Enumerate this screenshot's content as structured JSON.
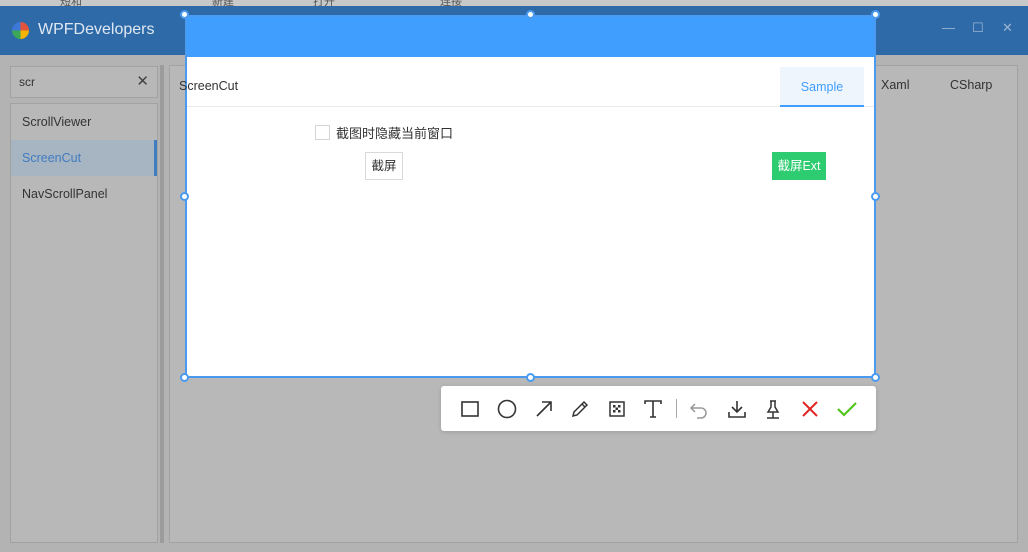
{
  "background_menu": [
    "短和",
    "新建",
    "打开",
    "连接"
  ],
  "window": {
    "title": "WPFDevelopers",
    "minimize_glyph": "—",
    "maximize_glyph": "☐",
    "close_glyph": "✕"
  },
  "search": {
    "value": "scr",
    "clear_glyph": "✕"
  },
  "nav": {
    "items": [
      {
        "label": "ScrollViewer"
      },
      {
        "label": "ScreenCut",
        "active": true
      },
      {
        "label": "NavScrollPanel"
      }
    ]
  },
  "content_tabs": [
    "Xaml",
    "CSharp"
  ],
  "sample": {
    "header_title": "ScreenCut",
    "tab_label": "Sample",
    "checkbox_label": "截图时隐藏当前窗口",
    "checkbox_checked": false,
    "cut_button": "截屏",
    "cut_ext_button": "截屏Ext"
  },
  "toolbar": {
    "tools": [
      "rectangle-icon",
      "ellipse-icon",
      "arrow-icon",
      "pen-icon",
      "mosaic-icon",
      "text-icon",
      "undo-icon",
      "save-icon",
      "pin-icon",
      "cancel-icon",
      "confirm-icon"
    ]
  },
  "colors": {
    "accent": "#409eff",
    "titlebar": "#2f6aa8",
    "success_button": "#2ecc71",
    "cancel": "#e02424",
    "confirm": "#52c41a"
  }
}
